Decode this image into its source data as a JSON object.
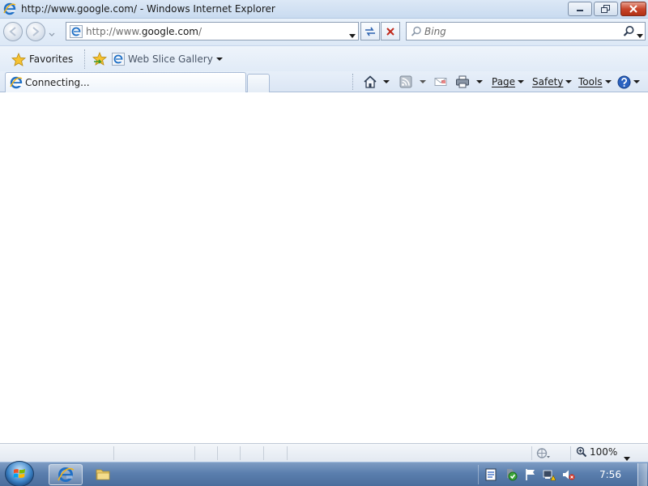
{
  "window": {
    "title": "http://www.google.com/ - Windows Internet Explorer"
  },
  "navigation": {
    "address_prefix": "http://www.",
    "address_domain": "google.com",
    "address_suffix": "/",
    "search_placeholder": "Bing"
  },
  "favorites_bar": {
    "favorites_label": "Favorites",
    "web_slice_label": "Web Slice Gallery"
  },
  "tabs": [
    {
      "label": "Connecting..."
    }
  ],
  "command_bar": {
    "page_label": "Page",
    "safety_label": "Safety",
    "tools_label": "Tools"
  },
  "status_bar": {
    "zoom": "100%"
  },
  "taskbar": {
    "clock": "7:56"
  },
  "colors": {
    "close_button": "#c8452b",
    "taskbar": "#5b7fae",
    "ie_blue": "#1f6fc5"
  }
}
